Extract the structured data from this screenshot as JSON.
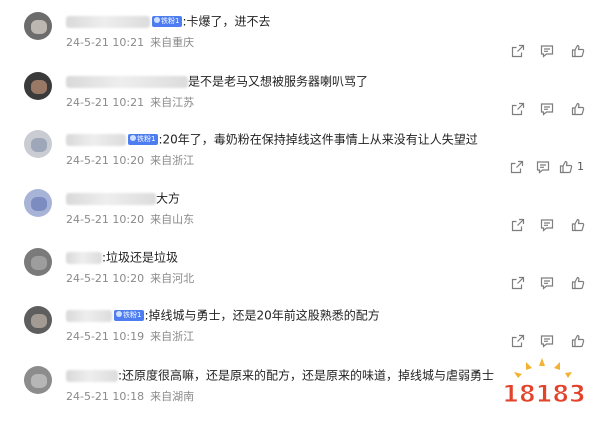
{
  "badge_text": "铁粉1",
  "comments": [
    {
      "text": ":卡爆了，进不去",
      "date": "24-5-21 10:21",
      "location": "来自重庆",
      "badge": true,
      "likes": ""
    },
    {
      "text": "是不是老马又想被服务器喇叭骂了",
      "date": "24-5-21 10:21",
      "location": "来自江苏",
      "badge": false,
      "likes": ""
    },
    {
      "text": ":20年了，毒奶粉在保持掉线这件事情上从来没有让人失望过",
      "date": "24-5-21 10:20",
      "location": "来自浙江",
      "badge": true,
      "likes": "1"
    },
    {
      "text": "大方",
      "date": "24-5-21 10:20",
      "location": "来自山东",
      "badge": false,
      "likes": ""
    },
    {
      "text": ":垃圾还是垃圾",
      "date": "24-5-21 10:20",
      "location": "来自河北",
      "badge": false,
      "likes": ""
    },
    {
      "text": ":掉线城与勇士，还是20年前这股熟悉的配方",
      "date": "24-5-21 10:19",
      "location": "来自浙江",
      "badge": true,
      "likes": ""
    },
    {
      "text": ":还原度很高嘛，还是原来的配方，还是原来的味道，掉线城与虐弱勇士",
      "date": "24-5-21 10:18",
      "location": "来自湖南",
      "badge": false,
      "likes": ""
    }
  ],
  "watermark": {
    "text": "18183"
  },
  "colors": {
    "meta": "#8a8a8a",
    "badge": "#4d7df0",
    "watermark": "#e2432b"
  }
}
